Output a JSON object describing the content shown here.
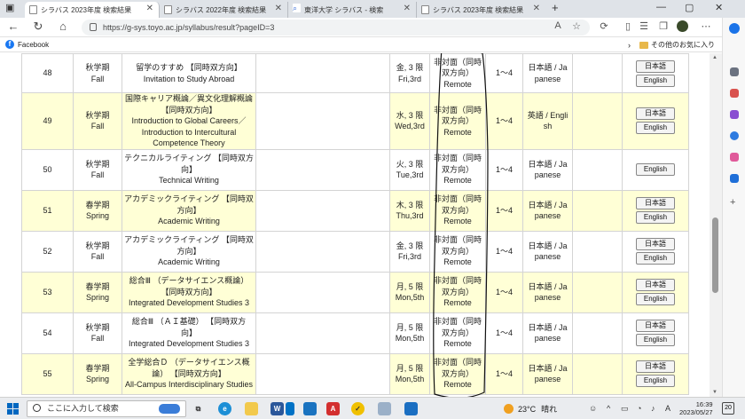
{
  "browser": {
    "tabs": [
      {
        "label": "シラバス 2023年度 検索結果",
        "active": true
      },
      {
        "label": "シラバス 2022年度 検索結果",
        "active": false
      },
      {
        "label": "東洋大学 シラバス - 検索",
        "active": false
      },
      {
        "label": "シラバス 2023年度 検索結果",
        "active": false
      }
    ],
    "new_tab": "+",
    "url": "https://g-sys.toyo.ac.jp/syllabus/result?pageID=3",
    "favorites": [
      {
        "label": "Facebook"
      }
    ],
    "other_favorites": "その他のお気に入り"
  },
  "table": {
    "rows": [
      {
        "no": "48",
        "term_ja": "秋学期",
        "term_en": "Fall",
        "title_ja": "留学のすすめ 【同時双方向】",
        "title_en": "Invitation to Study Abroad",
        "time_ja": "金, 3 限",
        "time_en": "Fri,3rd",
        "mode_ja": "非対面（同時双方向）",
        "mode_en": "Remote",
        "credits": "1〜4",
        "lang_ja": "日本語 / Ja",
        "lang_en": "panese",
        "btn_ja": "日本語",
        "btn_en": "English"
      },
      {
        "no": "49",
        "term_ja": "秋学期",
        "term_en": "Fall",
        "title_ja": "国際キャリア概論／異文化理解概論 【同時双方向】",
        "title_en": "Introduction to Global Careers／Introduction to Intercultural Competence Theory",
        "time_ja": "水, 3 限",
        "time_en": "Wed,3rd",
        "mode_ja": "非対面（同時双方向）",
        "mode_en": "Remote",
        "credits": "1〜4",
        "lang_ja": "英語 / Engli",
        "lang_en": "sh",
        "btn_ja": "日本語",
        "btn_en": "English"
      },
      {
        "no": "50",
        "term_ja": "秋学期",
        "term_en": "Fall",
        "title_ja": "テクニカルライティング 【同時双方向】",
        "title_en": "Technical Writing",
        "time_ja": "火, 3 限",
        "time_en": "Tue,3rd",
        "mode_ja": "非対面（同時双方向）",
        "mode_en": "Remote",
        "credits": "1〜4",
        "lang_ja": "日本語 / Ja",
        "lang_en": "panese",
        "btn_ja": "",
        "btn_en": "English"
      },
      {
        "no": "51",
        "term_ja": "春学期",
        "term_en": "Spring",
        "title_ja": "アカデミックライティング 【同時双方向】",
        "title_en": "Academic Writing",
        "time_ja": "木, 3 限",
        "time_en": "Thu,3rd",
        "mode_ja": "非対面（同時双方向）",
        "mode_en": "Remote",
        "credits": "1〜4",
        "lang_ja": "日本語 / Ja",
        "lang_en": "panese",
        "btn_ja": "日本語",
        "btn_en": "English"
      },
      {
        "no": "52",
        "term_ja": "秋学期",
        "term_en": "Fall",
        "title_ja": "アカデミックライティング 【同時双方向】",
        "title_en": "Academic Writing",
        "time_ja": "金, 3 限",
        "time_en": "Fri,3rd",
        "mode_ja": "非対面（同時双方向）",
        "mode_en": "Remote",
        "credits": "1〜4",
        "lang_ja": "日本語 / Ja",
        "lang_en": "panese",
        "btn_ja": "日本語",
        "btn_en": "English"
      },
      {
        "no": "53",
        "term_ja": "春学期",
        "term_en": "Spring",
        "title_ja": "総合Ⅲ （データサイエンス概論）【同時双方向】",
        "title_en": "Integrated Development Studies 3",
        "time_ja": "月, 5 限",
        "time_en": "Mon,5th",
        "mode_ja": "非対面（同時双方向）",
        "mode_en": "Remote",
        "credits": "1〜4",
        "lang_ja": "日本語 / Ja",
        "lang_en": "panese",
        "btn_ja": "日本語",
        "btn_en": "English"
      },
      {
        "no": "54",
        "term_ja": "秋学期",
        "term_en": "Fall",
        "title_ja": "総合Ⅲ （ＡＩ基礎） 【同時双方向】",
        "title_en": "Integrated Development Studies 3",
        "time_ja": "月, 5 限",
        "time_en": "Mon,5th",
        "mode_ja": "非対面（同時双方向）",
        "mode_en": "Remote",
        "credits": "1〜4",
        "lang_ja": "日本語 / Ja",
        "lang_en": "panese",
        "btn_ja": "日本語",
        "btn_en": "English"
      },
      {
        "no": "55",
        "term_ja": "春学期",
        "term_en": "Spring",
        "title_ja": "全学総合Ｄ （データサイエンス概論） 【同時双方向】",
        "title_en": "All-Campus Interdisciplinary Studies",
        "time_ja": "月, 5 限",
        "time_en": "Mon,5th",
        "mode_ja": "非対面（同時双方向）",
        "mode_en": "Remote",
        "credits": "1〜4",
        "lang_ja": "日本語 / Ja",
        "lang_en": "panese",
        "btn_ja": "日本語",
        "btn_en": "English"
      }
    ]
  },
  "taskbar": {
    "search_placeholder": "ここに入力して検索",
    "weather_temp": "23°C",
    "weather_text": "晴れ",
    "ime": "A",
    "time": "16:39",
    "date": "2023/05/27",
    "notif_count": "20"
  }
}
